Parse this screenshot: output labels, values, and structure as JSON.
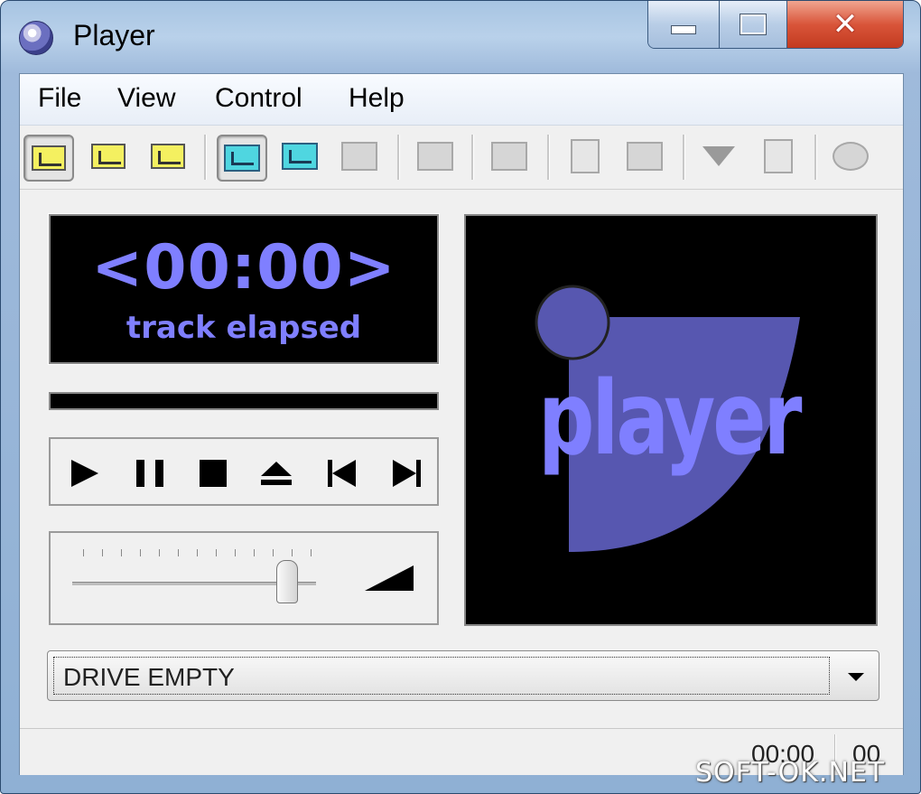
{
  "window": {
    "title": "Player"
  },
  "menu": {
    "items": [
      "File",
      "View",
      "Control",
      "Help"
    ]
  },
  "display": {
    "time": "<00:00>",
    "mode_label": "track elapsed",
    "progress": 0,
    "logo_text": "player",
    "accent_color": "#7f7fff"
  },
  "volume": {
    "level": 0.88
  },
  "drive": {
    "selected": "DRIVE EMPTY"
  },
  "status": {
    "time": "00:00",
    "track": "00"
  },
  "watermark": "SOFT-OK.NET",
  "icons": {
    "toolbar": [
      "normal-mode-icon",
      "repeat-track-icon",
      "repeat-disc-icon",
      "single-play-icon",
      "random-order-icon",
      "multi-disc-icon",
      "intro-scan-icon",
      "edit-playlist-icon",
      "track-info-icon",
      "album-art-icon",
      "download-icon",
      "export-icon",
      "options-icon"
    ],
    "controls": [
      "play-icon",
      "pause-icon",
      "stop-icon",
      "eject-icon",
      "previous-track-icon",
      "next-track-icon"
    ]
  }
}
